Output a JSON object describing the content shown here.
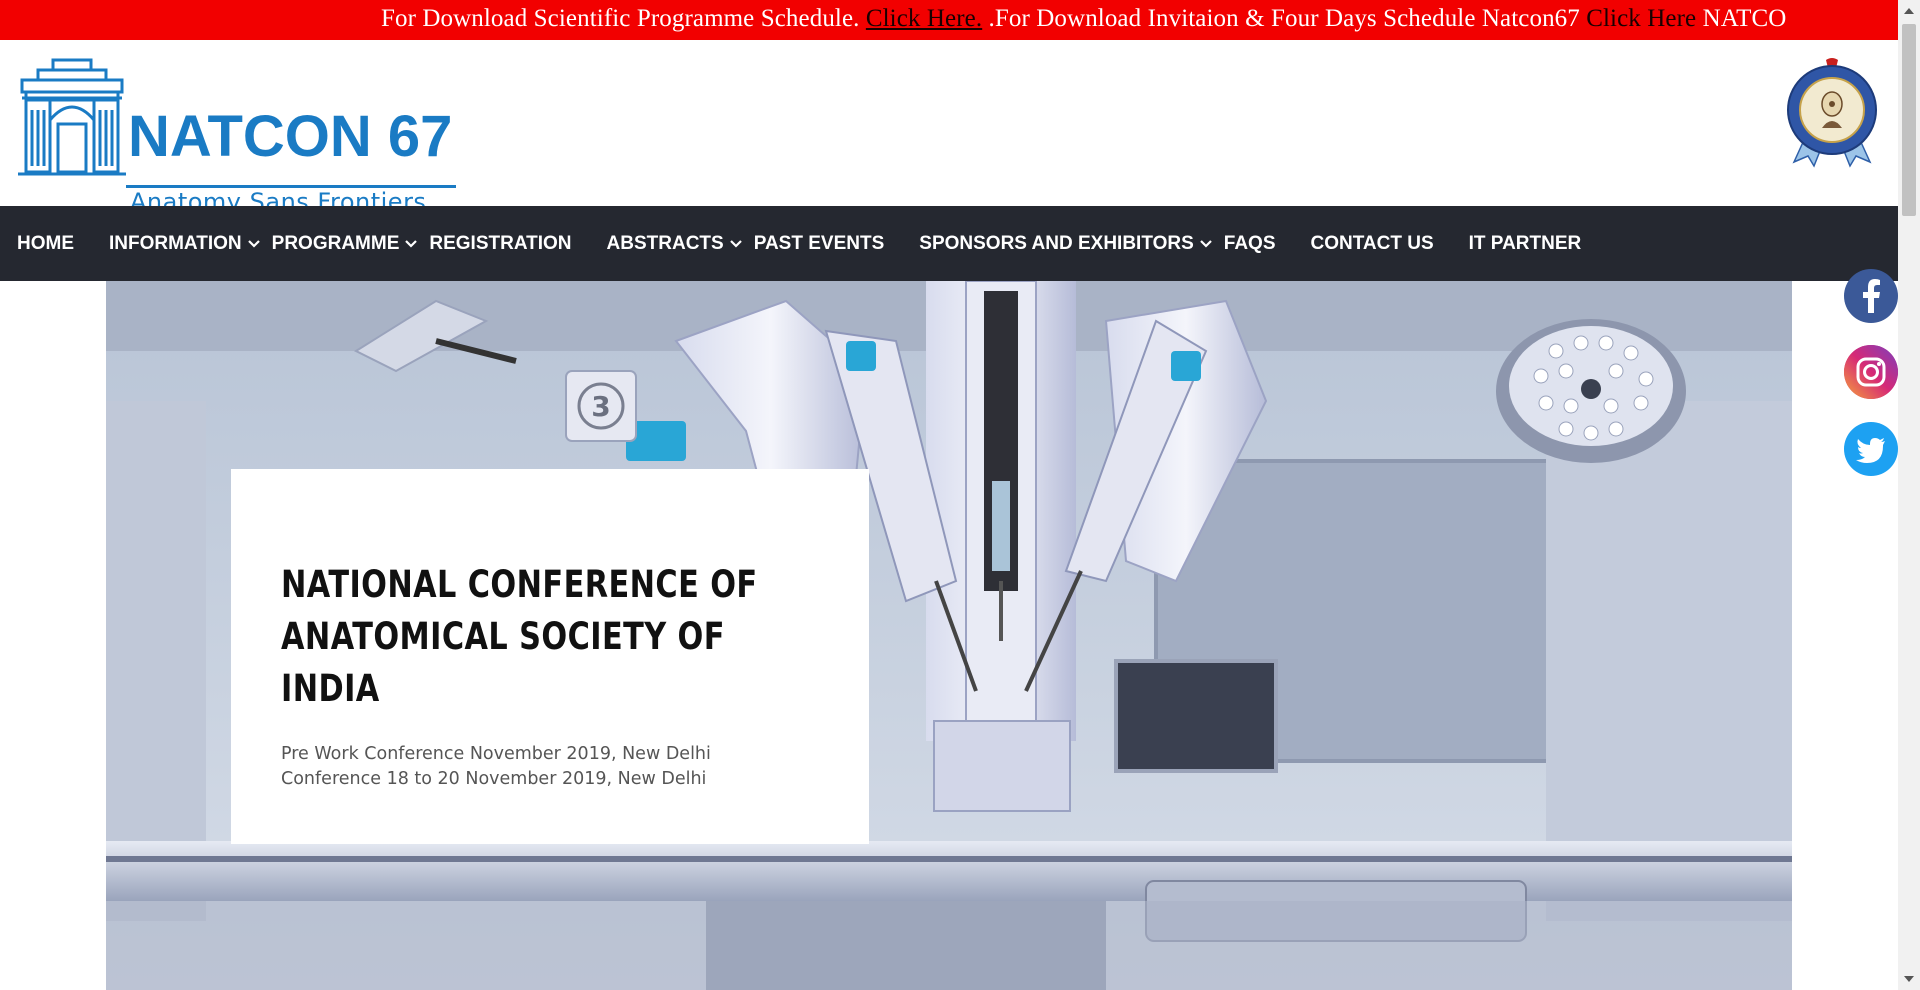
{
  "marquee": {
    "text1": "For Download Scientific Programme Schedule. ",
    "link1": "Click Here.",
    "text2": " .For Download Invitaion & Four Days Schedule Natcon67 ",
    "link2": "Click Here",
    "text3": " NATCO"
  },
  "logo": {
    "title": "NATCON 67",
    "subtitle": "Anatomy Sans Frontiers"
  },
  "nav": {
    "items": [
      {
        "label": "HOME"
      },
      {
        "label": "INFORMATION"
      },
      {
        "label": "PROGRAMME"
      },
      {
        "label": "REGISTRATION"
      },
      {
        "label": "ABSTRACTS"
      },
      {
        "label": "PAST EVENTS"
      },
      {
        "label": "SPONSORS AND EXHIBITORS"
      },
      {
        "label": "FAQS"
      },
      {
        "label": "CONTACT US"
      },
      {
        "label": "IT PARTNER"
      }
    ]
  },
  "hero": {
    "title": "NATIONAL CONFERENCE OF ANATOMICAL SOCIETY OF INDIA",
    "line1": "Pre Work Conference November 2019, New Delhi",
    "line2": "Conference 18 to 20 November 2019, New Delhi",
    "badge_number": "3"
  },
  "colors": {
    "marquee_bg": "#f20000",
    "brand_blue": "#1a7bc4",
    "nav_bg": "#252830"
  },
  "social": [
    "facebook-icon",
    "instagram-icon",
    "twitter-icon"
  ]
}
